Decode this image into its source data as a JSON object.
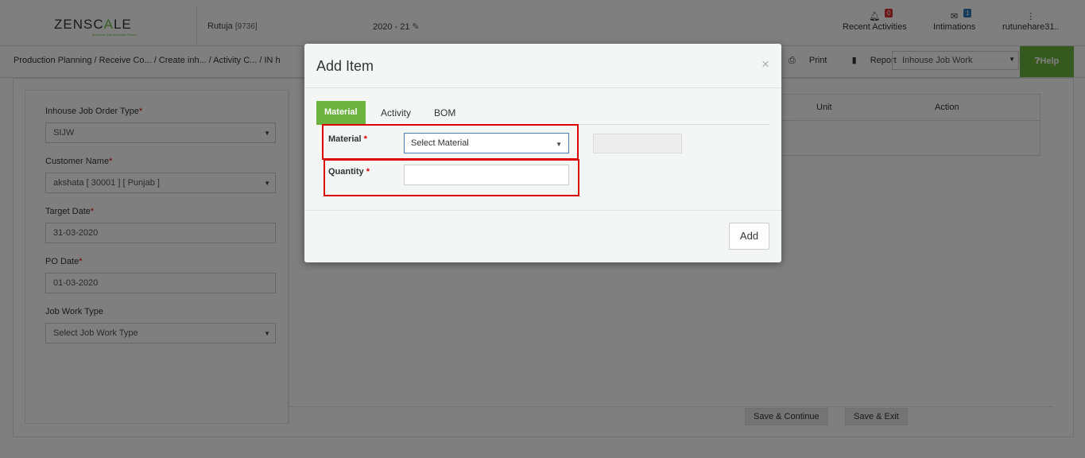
{
  "header": {
    "logo_main": "ZENSC",
    "logo_mid": "A",
    "logo_end": "LE",
    "logo_tagline": "Business Gain Business Peace",
    "user_name": "Rutuja",
    "user_code": "[9736]",
    "fiscal_year": "2020 - 21",
    "recent_activities": {
      "label": "Recent Activities",
      "count": "0"
    },
    "intimations": {
      "label": "Intimations",
      "count": "1"
    },
    "account": "rutunehare31.."
  },
  "toolbar": {
    "breadcrumb": "Production Planning  / Receive Co... / Create inh... / Activity C... / IN h",
    "print_label": "Print",
    "report_label": "Report",
    "type_value": "Inhouse Job Work",
    "help_label": "Help"
  },
  "form": {
    "order_type": {
      "label": "Inhouse Job Order Type",
      "value": "SIJW"
    },
    "customer": {
      "label": "Customer Name",
      "value": "akshata [ 30001 ] [ Punjab ]"
    },
    "target_date": {
      "label": "Target Date",
      "value": "31-03-2020"
    },
    "po_date": {
      "label": "PO Date",
      "value": "01-03-2020"
    },
    "job_work_type": {
      "label": "Job Work Type",
      "value": "Select Job Work Type"
    }
  },
  "table": {
    "columns": [
      "Unit",
      "Action"
    ]
  },
  "footer_buttons": {
    "save_continue": "Save & Continue",
    "save_exit": "Save & Exit"
  },
  "modal": {
    "title": "Add Item",
    "close": "×",
    "tabs": [
      "Material",
      "Activity",
      "BOM"
    ],
    "material_label": "Material",
    "material_value": "Select Material",
    "quantity_label": "Quantity",
    "quantity_value": "",
    "add_label": "Add"
  },
  "colors": {
    "accent": "#6cb33f",
    "highlight": "#dd0000",
    "badge_red": "#d9302c",
    "badge_blue": "#2f78b8"
  }
}
